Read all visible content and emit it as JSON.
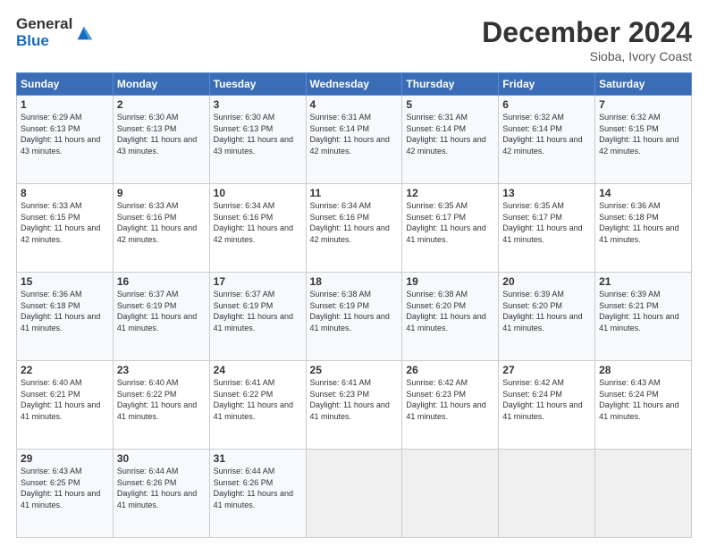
{
  "logo": {
    "general": "General",
    "blue": "Blue"
  },
  "title": "December 2024",
  "subtitle": "Sioba, Ivory Coast",
  "days_of_week": [
    "Sunday",
    "Monday",
    "Tuesday",
    "Wednesday",
    "Thursday",
    "Friday",
    "Saturday"
  ],
  "weeks": [
    [
      {
        "day": "1",
        "sunrise": "Sunrise: 6:29 AM",
        "sunset": "Sunset: 6:13 PM",
        "daylight": "Daylight: 11 hours and 43 minutes."
      },
      {
        "day": "2",
        "sunrise": "Sunrise: 6:30 AM",
        "sunset": "Sunset: 6:13 PM",
        "daylight": "Daylight: 11 hours and 43 minutes."
      },
      {
        "day": "3",
        "sunrise": "Sunrise: 6:30 AM",
        "sunset": "Sunset: 6:13 PM",
        "daylight": "Daylight: 11 hours and 43 minutes."
      },
      {
        "day": "4",
        "sunrise": "Sunrise: 6:31 AM",
        "sunset": "Sunset: 6:14 PM",
        "daylight": "Daylight: 11 hours and 42 minutes."
      },
      {
        "day": "5",
        "sunrise": "Sunrise: 6:31 AM",
        "sunset": "Sunset: 6:14 PM",
        "daylight": "Daylight: 11 hours and 42 minutes."
      },
      {
        "day": "6",
        "sunrise": "Sunrise: 6:32 AM",
        "sunset": "Sunset: 6:14 PM",
        "daylight": "Daylight: 11 hours and 42 minutes."
      },
      {
        "day": "7",
        "sunrise": "Sunrise: 6:32 AM",
        "sunset": "Sunset: 6:15 PM",
        "daylight": "Daylight: 11 hours and 42 minutes."
      }
    ],
    [
      {
        "day": "8",
        "sunrise": "Sunrise: 6:33 AM",
        "sunset": "Sunset: 6:15 PM",
        "daylight": "Daylight: 11 hours and 42 minutes."
      },
      {
        "day": "9",
        "sunrise": "Sunrise: 6:33 AM",
        "sunset": "Sunset: 6:16 PM",
        "daylight": "Daylight: 11 hours and 42 minutes."
      },
      {
        "day": "10",
        "sunrise": "Sunrise: 6:34 AM",
        "sunset": "Sunset: 6:16 PM",
        "daylight": "Daylight: 11 hours and 42 minutes."
      },
      {
        "day": "11",
        "sunrise": "Sunrise: 6:34 AM",
        "sunset": "Sunset: 6:16 PM",
        "daylight": "Daylight: 11 hours and 42 minutes."
      },
      {
        "day": "12",
        "sunrise": "Sunrise: 6:35 AM",
        "sunset": "Sunset: 6:17 PM",
        "daylight": "Daylight: 11 hours and 41 minutes."
      },
      {
        "day": "13",
        "sunrise": "Sunrise: 6:35 AM",
        "sunset": "Sunset: 6:17 PM",
        "daylight": "Daylight: 11 hours and 41 minutes."
      },
      {
        "day": "14",
        "sunrise": "Sunrise: 6:36 AM",
        "sunset": "Sunset: 6:18 PM",
        "daylight": "Daylight: 11 hours and 41 minutes."
      }
    ],
    [
      {
        "day": "15",
        "sunrise": "Sunrise: 6:36 AM",
        "sunset": "Sunset: 6:18 PM",
        "daylight": "Daylight: 11 hours and 41 minutes."
      },
      {
        "day": "16",
        "sunrise": "Sunrise: 6:37 AM",
        "sunset": "Sunset: 6:19 PM",
        "daylight": "Daylight: 11 hours and 41 minutes."
      },
      {
        "day": "17",
        "sunrise": "Sunrise: 6:37 AM",
        "sunset": "Sunset: 6:19 PM",
        "daylight": "Daylight: 11 hours and 41 minutes."
      },
      {
        "day": "18",
        "sunrise": "Sunrise: 6:38 AM",
        "sunset": "Sunset: 6:19 PM",
        "daylight": "Daylight: 11 hours and 41 minutes."
      },
      {
        "day": "19",
        "sunrise": "Sunrise: 6:38 AM",
        "sunset": "Sunset: 6:20 PM",
        "daylight": "Daylight: 11 hours and 41 minutes."
      },
      {
        "day": "20",
        "sunrise": "Sunrise: 6:39 AM",
        "sunset": "Sunset: 6:20 PM",
        "daylight": "Daylight: 11 hours and 41 minutes."
      },
      {
        "day": "21",
        "sunrise": "Sunrise: 6:39 AM",
        "sunset": "Sunset: 6:21 PM",
        "daylight": "Daylight: 11 hours and 41 minutes."
      }
    ],
    [
      {
        "day": "22",
        "sunrise": "Sunrise: 6:40 AM",
        "sunset": "Sunset: 6:21 PM",
        "daylight": "Daylight: 11 hours and 41 minutes."
      },
      {
        "day": "23",
        "sunrise": "Sunrise: 6:40 AM",
        "sunset": "Sunset: 6:22 PM",
        "daylight": "Daylight: 11 hours and 41 minutes."
      },
      {
        "day": "24",
        "sunrise": "Sunrise: 6:41 AM",
        "sunset": "Sunset: 6:22 PM",
        "daylight": "Daylight: 11 hours and 41 minutes."
      },
      {
        "day": "25",
        "sunrise": "Sunrise: 6:41 AM",
        "sunset": "Sunset: 6:23 PM",
        "daylight": "Daylight: 11 hours and 41 minutes."
      },
      {
        "day": "26",
        "sunrise": "Sunrise: 6:42 AM",
        "sunset": "Sunset: 6:23 PM",
        "daylight": "Daylight: 11 hours and 41 minutes."
      },
      {
        "day": "27",
        "sunrise": "Sunrise: 6:42 AM",
        "sunset": "Sunset: 6:24 PM",
        "daylight": "Daylight: 11 hours and 41 minutes."
      },
      {
        "day": "28",
        "sunrise": "Sunrise: 6:43 AM",
        "sunset": "Sunset: 6:24 PM",
        "daylight": "Daylight: 11 hours and 41 minutes."
      }
    ],
    [
      {
        "day": "29",
        "sunrise": "Sunrise: 6:43 AM",
        "sunset": "Sunset: 6:25 PM",
        "daylight": "Daylight: 11 hours and 41 minutes."
      },
      {
        "day": "30",
        "sunrise": "Sunrise: 6:44 AM",
        "sunset": "Sunset: 6:26 PM",
        "daylight": "Daylight: 11 hours and 41 minutes."
      },
      {
        "day": "31",
        "sunrise": "Sunrise: 6:44 AM",
        "sunset": "Sunset: 6:26 PM",
        "daylight": "Daylight: 11 hours and 41 minutes."
      },
      null,
      null,
      null,
      null
    ]
  ]
}
